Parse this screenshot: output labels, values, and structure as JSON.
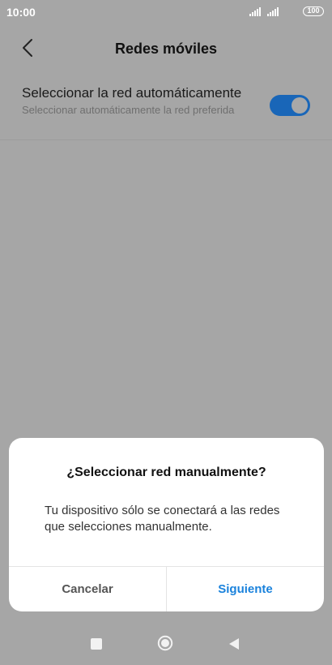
{
  "status_bar": {
    "time": "10:00",
    "battery": "100",
    "icons": [
      "signal-icon",
      "signal-icon",
      "battery-icon"
    ]
  },
  "header": {
    "title": "Redes móviles",
    "back_icon": "chevron-left-icon"
  },
  "setting": {
    "title": "Seleccionar la red automáticamente",
    "subtitle": "Seleccionar automáticamente la red preferida",
    "toggle_on": true
  },
  "dialog": {
    "title": "¿Seleccionar red manualmente?",
    "message": "Tu dispositivo sólo se conectará a las redes que selecciones manualmente.",
    "cancel_label": "Cancelar",
    "next_label": "Siguiente"
  },
  "nav_bar": {
    "icons": [
      "recent-apps-icon",
      "home-icon",
      "back-triangle-icon"
    ]
  },
  "colors": {
    "accent": "#1a82dc",
    "toggle": "#1966b8",
    "scrim": "#a6a6a6"
  }
}
